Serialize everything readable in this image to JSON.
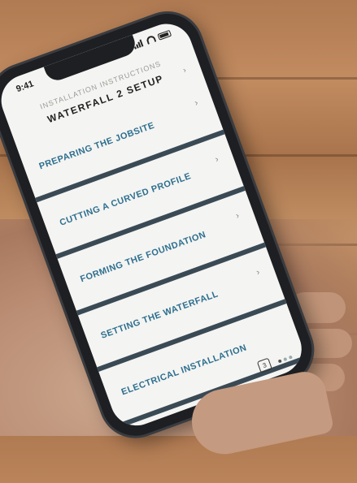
{
  "status_bar": {
    "time": "9:41"
  },
  "header": {
    "subtitle": "INSTALLATION INSTRUCTIONS",
    "title": "WATERFALL 2 SETUP"
  },
  "menu": {
    "items": [
      {
        "label": "PREPARING THE JOBSITE"
      },
      {
        "label": "CUTTING A CURVED PROFILE"
      },
      {
        "label": "FORMING THE FOUNDATION"
      },
      {
        "label": "SETTING THE WATERFALL"
      },
      {
        "label": "ELECTRICAL INSTALLATION"
      }
    ]
  },
  "footer": {
    "page_number": "3"
  },
  "colors": {
    "accent": "#2d6f8f",
    "divider": "#3a4a55",
    "background": "#f4f4f2"
  }
}
